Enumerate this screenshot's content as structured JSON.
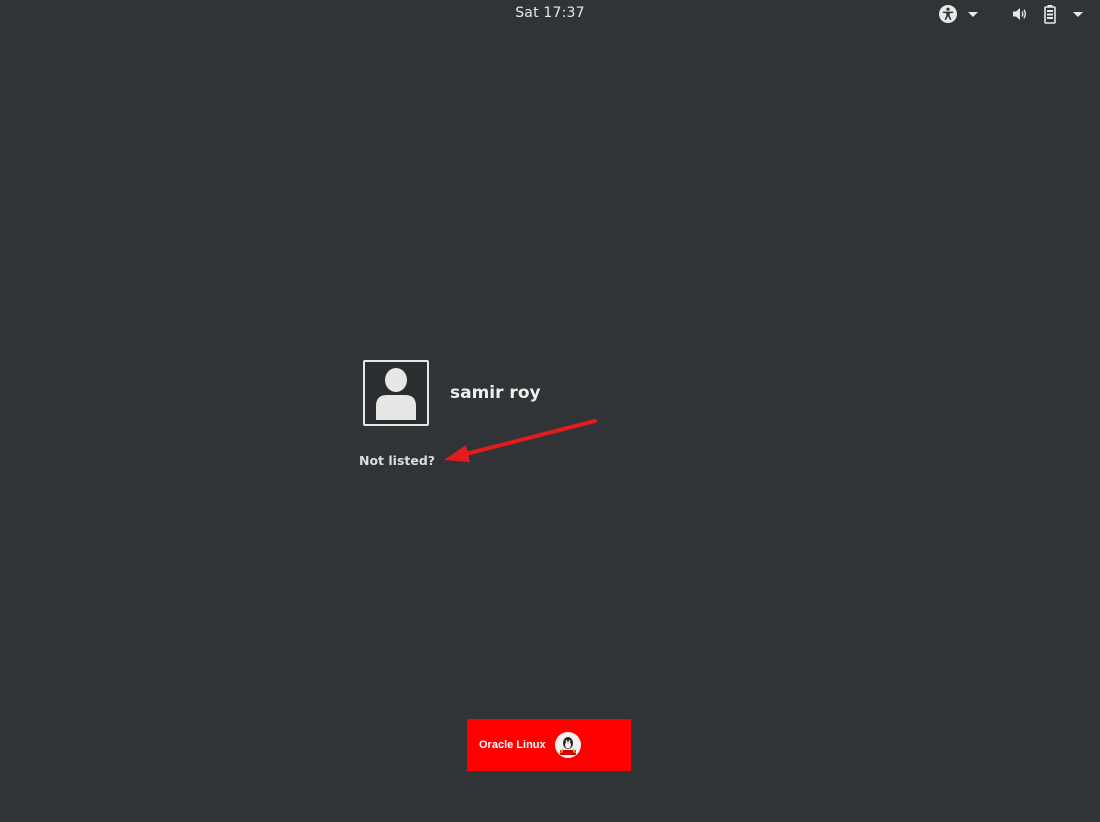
{
  "topbar": {
    "clock": "Sat 17:37",
    "accessibility_icon": "accessibility-icon",
    "volume_icon": "volume-icon",
    "battery_icon": "battery-icon",
    "menu_caret_icon": "chevron-down-icon"
  },
  "login": {
    "users": [
      {
        "name": "samir roy",
        "avatar_icon": "user-avatar-icon"
      }
    ],
    "not_listed_label": "Not listed?"
  },
  "annotation": {
    "arrow_color": "#e21b1b"
  },
  "branding": {
    "logo_text": "Oracle Linux",
    "logo_bg": "#ff0000",
    "logo_mascot_icon": "tux-mascot-icon"
  },
  "colors": {
    "background": "#303437",
    "text": "#eeeeec"
  }
}
